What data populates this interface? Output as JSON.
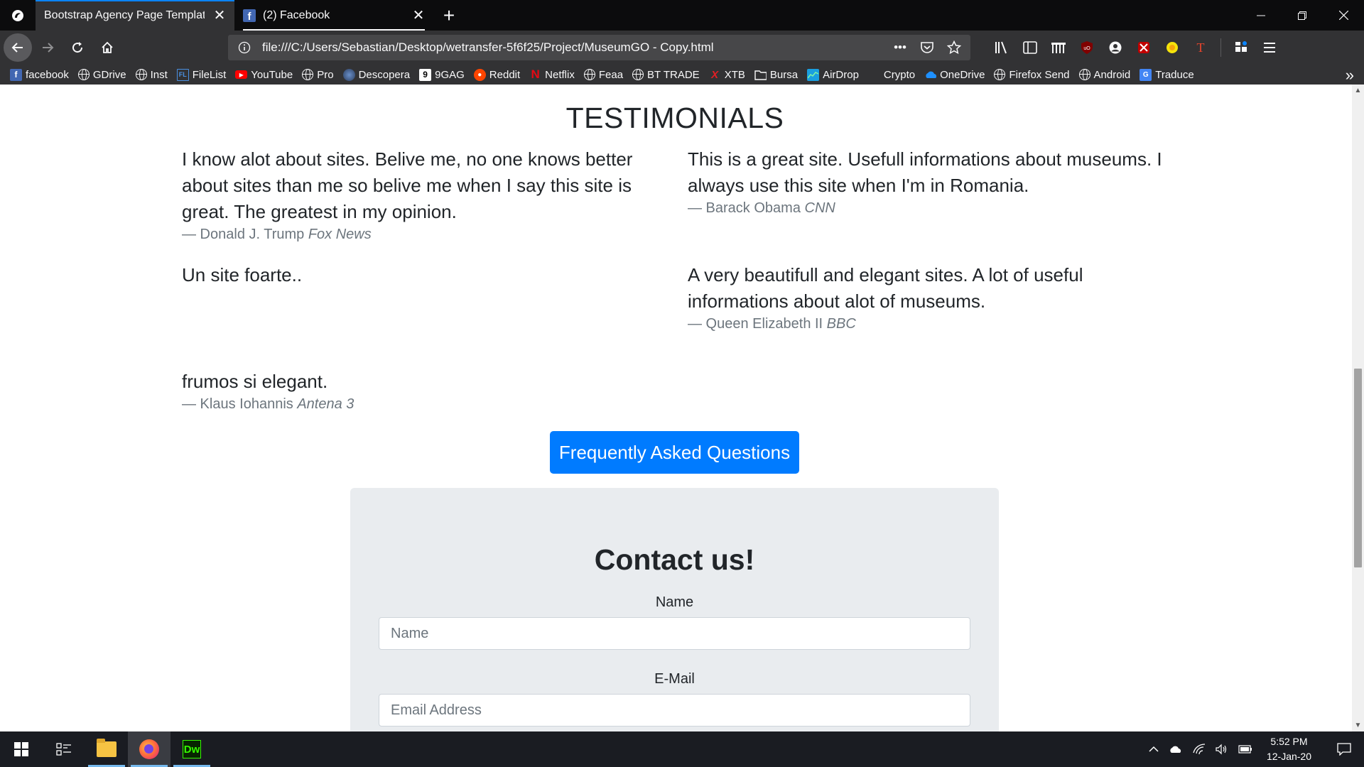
{
  "tabs": [
    {
      "title": "Bootstrap Agency Page Template",
      "selected": true
    },
    {
      "title": "(2) Facebook",
      "selected": false
    }
  ],
  "navbar": {
    "url": "file:///C:/Users/Sebastian/Desktop/wetransfer-5f6f25/Project/MuseumGO - Copy.html",
    "page_actions": "•••"
  },
  "bookmarks": [
    {
      "label": "facebook",
      "icon": "facebook-icon"
    },
    {
      "label": "GDrive",
      "icon": "globe-icon"
    },
    {
      "label": "Inst",
      "icon": "globe-icon"
    },
    {
      "label": "FileList",
      "icon": "filelist-icon"
    },
    {
      "label": "YouTube",
      "icon": "youtube-icon"
    },
    {
      "label": "Pro",
      "icon": "globe-icon"
    },
    {
      "label": "Descopera",
      "icon": "descopera-icon"
    },
    {
      "label": "9GAG",
      "icon": "9gag-icon"
    },
    {
      "label": "Reddit",
      "icon": "reddit-icon"
    },
    {
      "label": "Netflix",
      "icon": "netflix-icon"
    },
    {
      "label": "Feaa",
      "icon": "globe-icon"
    },
    {
      "label": "BT TRADE",
      "icon": "globe-icon"
    },
    {
      "label": "XTB",
      "icon": "xtb-icon"
    },
    {
      "label": "Bursa",
      "icon": "folder-icon"
    },
    {
      "label": "AirDrop",
      "icon": "airdrop-icon"
    },
    {
      "label": "Crypto",
      "icon": "crypto-icon"
    },
    {
      "label": "OneDrive",
      "icon": "onedrive-icon"
    },
    {
      "label": "Firefox Send",
      "icon": "globe-icon"
    },
    {
      "label": "Android",
      "icon": "globe-icon"
    },
    {
      "label": "Traduce",
      "icon": "translate-icon"
    }
  ],
  "page": {
    "heading": "TESTIMONIALS",
    "testimonials": [
      {
        "quote": "I know alot about sites. Belive me, no one knows better about sites than me so belive me when I say this site is great. The greatest in my opinion.",
        "author": "— Donald J. Trump ",
        "source": "Fox News"
      },
      {
        "quote": "This is a great site. Usefull informations about museums. I always use this site when I'm in Romania.",
        "author": "— Barack Obama ",
        "source": "CNN"
      },
      {
        "quote": "Un site foarte..",
        "author": "",
        "source": ""
      },
      {
        "quote": "A very beautifull and elegant sites. A lot of useful informations about alot of museums.",
        "author": "— Queen Elizabeth II ",
        "source": "BBC"
      },
      {
        "quote": "frumos si elegant.",
        "author": "— Klaus Iohannis ",
        "source": "Antena 3"
      }
    ],
    "faq_button": "Frequently Asked Questions",
    "contact": {
      "title": "Contact us!",
      "name_label": "Name",
      "name_placeholder": "Name",
      "email_label": "E-Mail",
      "email_placeholder": "Email Address"
    }
  },
  "taskbar": {
    "time": "5:52 PM",
    "date": "12-Jan-20"
  },
  "colors": {
    "accent_tab": "#0a84ff",
    "primary_button": "#007bff",
    "contact_bg": "#e9ecef"
  }
}
